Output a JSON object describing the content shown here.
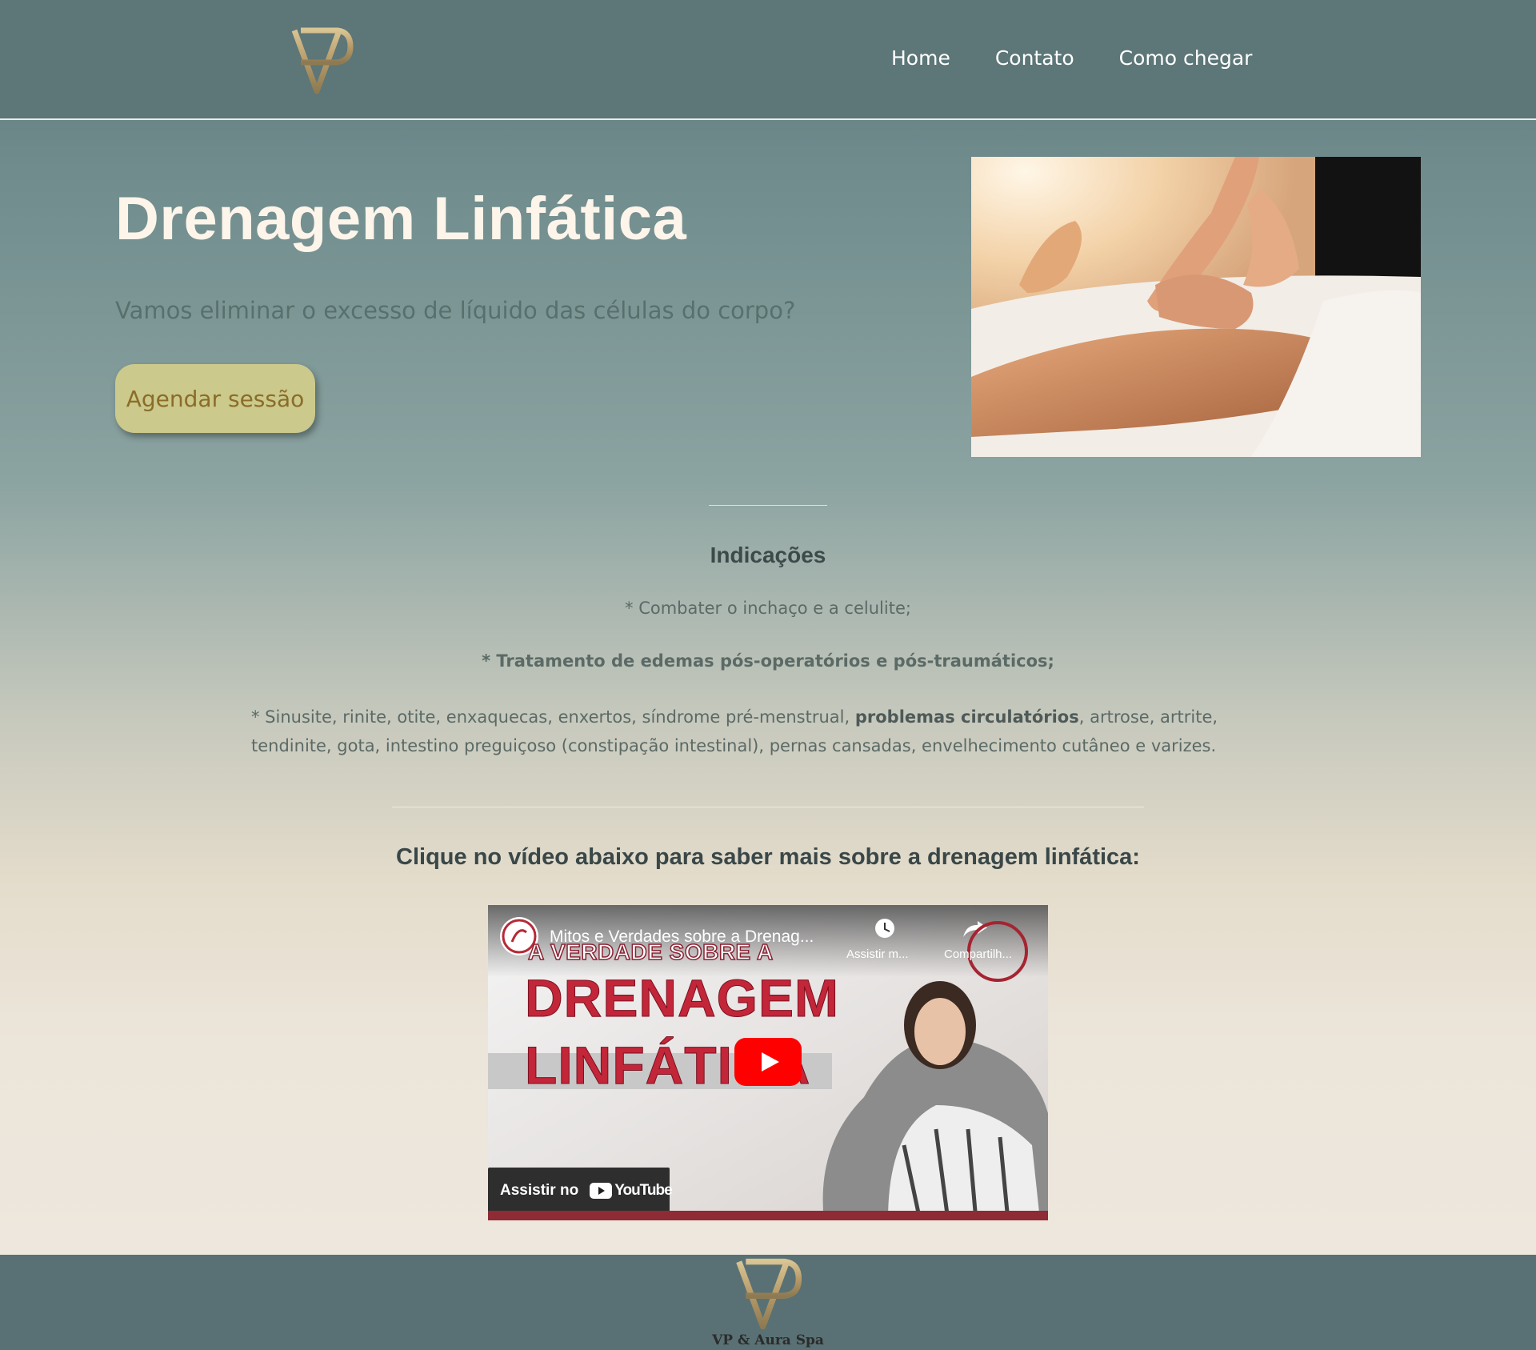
{
  "nav": {
    "items": [
      "Home",
      "Contato",
      "Como chegar"
    ]
  },
  "hero": {
    "title": "Drenagem Linfática",
    "subtitle": "Vamos eliminar o excesso de líquido das células do corpo?",
    "cta": "Agendar sessão"
  },
  "indications": {
    "title": "Indicações",
    "line1": "* Combater o inchaço e a celulite;",
    "line2": "* Tratamento de edemas pós-operatórios e pós-traumáticos;",
    "para_a": "* Sinusite, rinite, otite, enxaquecas, enxertos, síndrome pré-menstrual, ",
    "para_bold": "problemas circulatórios",
    "para_b": ", artrose, artrite, tendinite, gota, intestino preguiçoso (constipação intestinal), pernas cansadas, envelhecimento cutâneo e varizes."
  },
  "video_section": {
    "caption": "Clique no vídeo abaixo para saber mais sobre a drenagem linfática:",
    "video_title": "Mitos e Verdades sobre a Drenag...",
    "thumb_line1": "A VERDADE SOBRE A",
    "thumb_line2": "DRENAGEM",
    "thumb_line3": "LINFÁTICA",
    "watch_later": "Assistir m...",
    "share": "Compartilh...",
    "watch_on": "Assistir no",
    "youtube": "YouTube"
  },
  "footer": {
    "name": "VP & Aura Spa"
  },
  "colors": {
    "header_bg": "#5d7678",
    "cta_bg": "#cbc98b",
    "cta_text": "#8a6c29",
    "title": "#fdf4ea",
    "logo_gold": "#c7ae7c"
  }
}
